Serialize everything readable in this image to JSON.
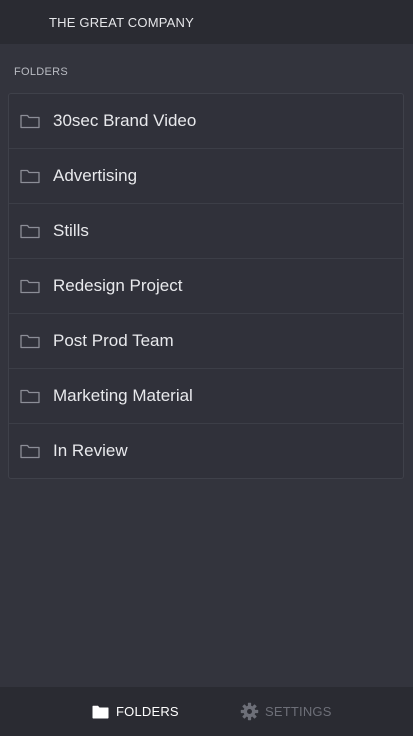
{
  "header": {
    "company_name": "THE GREAT COMPANY"
  },
  "main": {
    "section_label": "FOLDERS",
    "folders": [
      {
        "name": "30sec Brand Video",
        "icon": "folder-outline-icon"
      },
      {
        "name": "Advertising",
        "icon": "folder-outline-icon"
      },
      {
        "name": "Stills",
        "icon": "folder-outline-icon"
      },
      {
        "name": "Redesign Project",
        "icon": "folder-outline-icon"
      },
      {
        "name": "Post Prod Team",
        "icon": "folder-outline-icon"
      },
      {
        "name": "Marketing Material",
        "icon": "folder-outline-icon"
      },
      {
        "name": "In Review",
        "icon": "folder-outline-icon"
      }
    ]
  },
  "tabbar": {
    "folders_label": "FOLDERS",
    "folders_icon": "folder-filled-icon",
    "settings_label": "SETTINGS",
    "settings_icon": "gear-icon",
    "active_tab": "FOLDERS"
  },
  "colors": {
    "background": "#33343d",
    "bar": "#2a2b32",
    "text": "#e8e9ec",
    "muted": "#6d6f78"
  }
}
